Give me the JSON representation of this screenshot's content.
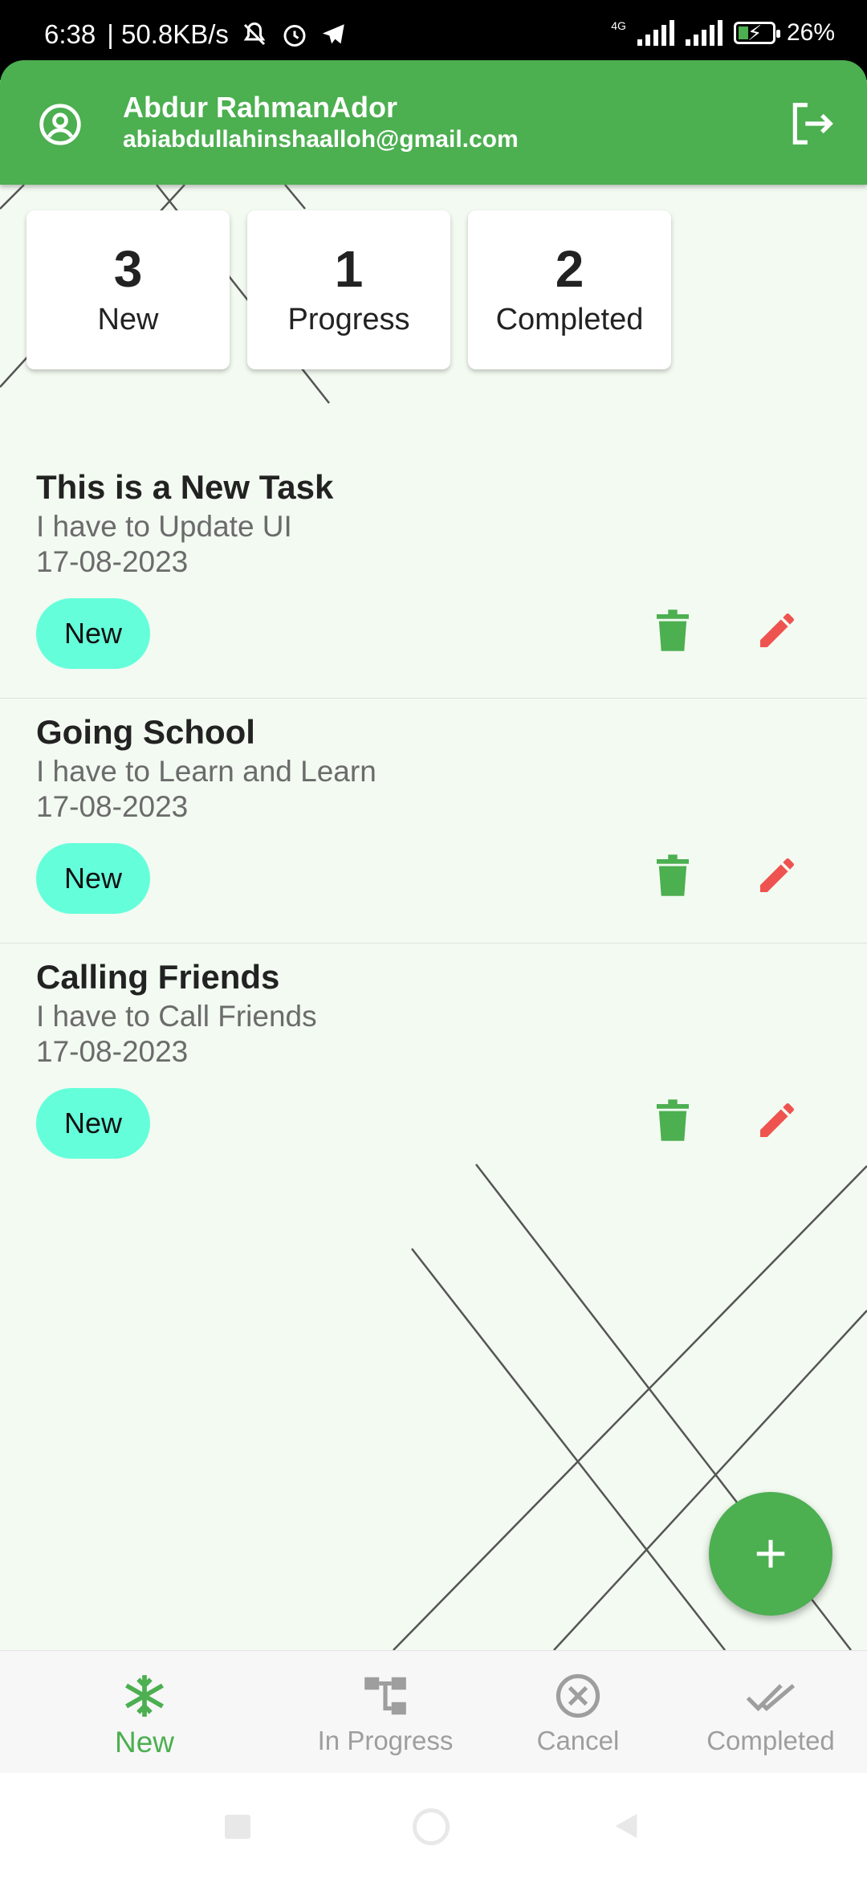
{
  "status_bar": {
    "time": "6:38",
    "speed": "| 50.8KB/s",
    "network": "4G",
    "battery": "26%"
  },
  "header": {
    "name": "Abdur RahmanAdor",
    "email": "abiabdullahinshaalloh@gmail.com"
  },
  "summary": [
    {
      "count": "3",
      "label": "New"
    },
    {
      "count": "1",
      "label": "Progress"
    },
    {
      "count": "2",
      "label": "Completed"
    }
  ],
  "tasks": [
    {
      "title": "This is a New Task",
      "description": "I have to Update UI",
      "date": "17-08-2023",
      "status": "New"
    },
    {
      "title": "Going School",
      "description": "I have to Learn and Learn",
      "date": "17-08-2023",
      "status": "New"
    },
    {
      "title": "Calling Friends",
      "description": "I have to Call Friends",
      "date": "17-08-2023",
      "status": "New"
    }
  ],
  "bottom_nav": {
    "items": [
      {
        "label": "New",
        "icon": "snowflake-icon",
        "active": true
      },
      {
        "label": "In Progress",
        "icon": "hierarchy-icon",
        "active": false
      },
      {
        "label": "Cancel",
        "icon": "cancel-circle-icon",
        "active": false
      },
      {
        "label": "Completed",
        "icon": "double-check-icon",
        "active": false
      }
    ]
  },
  "colors": {
    "primary": "#4caf50",
    "chip": "#64ffda",
    "edit": "#ef5350",
    "background": "#f2faf1"
  }
}
